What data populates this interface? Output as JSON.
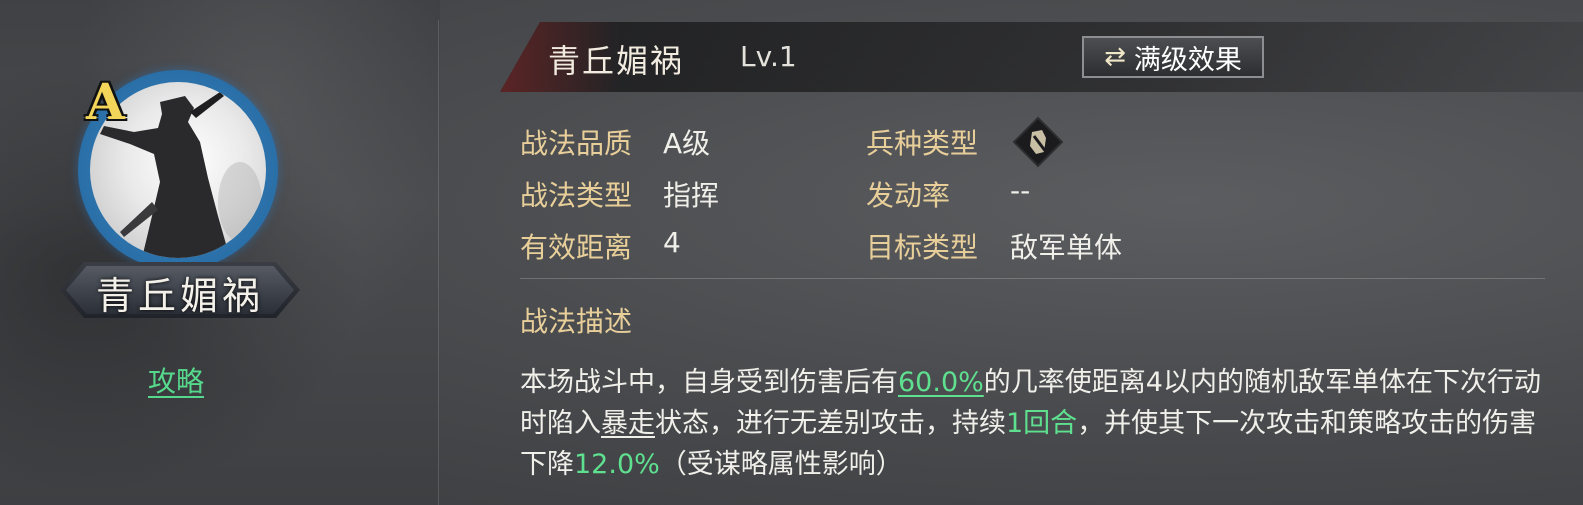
{
  "left": {
    "grade": "A",
    "hero_name": "青丘媚祸",
    "guide_label": "攻略"
  },
  "header": {
    "skill_name": "青丘媚祸",
    "level": "Lv.1",
    "max_level_button": "满级效果",
    "max_level_icon": "swap-arrows-icon"
  },
  "attributes": {
    "quality_label": "战法品质",
    "quality_value": "A级",
    "type_label": "战法类型",
    "type_value": "指挥",
    "range_label": "有效距离",
    "range_value": "4",
    "troop_label": "兵种类型",
    "troop_icon": "troop-type-icon",
    "rate_label": "发动率",
    "rate_value": "--",
    "target_label": "目标类型",
    "target_value": "敌军单体"
  },
  "description": {
    "title": "战法描述",
    "seg1": "本场战斗中，自身受到伤害后有",
    "chance": "60.0%",
    "seg2": "的几率使距离4以内的随机敌军单体在下次行动时陷入",
    "status": "暴走",
    "seg3": "状态，进行无差别攻击，持续",
    "duration": "1回合",
    "seg4": "，并使其下一次攻击和策略攻击的伤害下降",
    "reduction": "12.0%",
    "seg5": "（受谋略属性影响）"
  },
  "colors": {
    "label_gold": "#e8cf9a",
    "highlight_green": "#5fe08f",
    "grade_yellow": "#f3d55a",
    "ring_blue": "#2a6fa8"
  }
}
